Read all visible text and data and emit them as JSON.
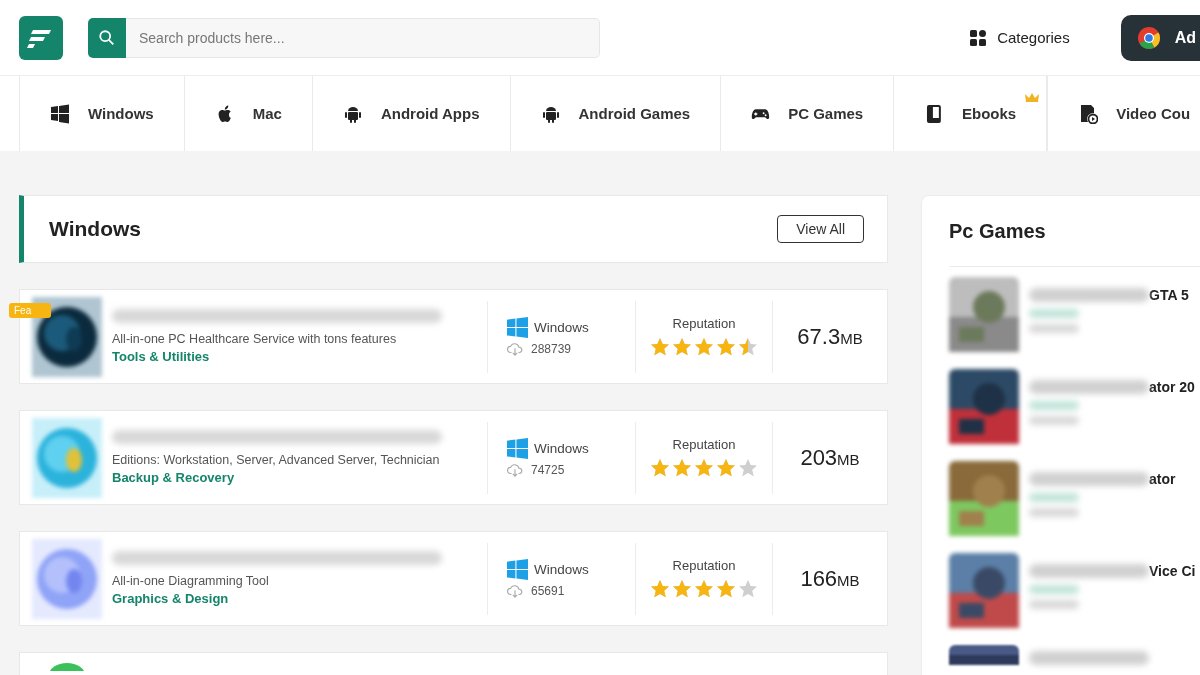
{
  "header": {
    "search": {
      "placeholder": "Search products here..."
    },
    "categories": "Categories",
    "extension_button": "Ad"
  },
  "nav": [
    {
      "kind": "windows",
      "label": "Windows",
      "crown": false
    },
    {
      "kind": "apple",
      "label": "Mac",
      "crown": false
    },
    {
      "kind": "android",
      "label": "Android Apps",
      "crown": false
    },
    {
      "kind": "android",
      "label": "Android Games",
      "crown": false
    },
    {
      "kind": "gamepad",
      "label": "PC Games",
      "crown": false
    },
    {
      "kind": "book",
      "label": "Ebooks",
      "crown": true
    },
    {
      "kind": "video",
      "label": "Video Cou",
      "crown": false
    }
  ],
  "windows_section": {
    "title": "Windows",
    "view_all": "View All",
    "items": [
      {
        "badge": "Fea",
        "description": "All-in-one PC Healthcare Service with tons features",
        "category": "Tools & Utilities",
        "platform": "Windows",
        "downloads": "288739",
        "reputation_label": "Reputation",
        "stars": 4.5,
        "size": "67.3",
        "unit": "MB"
      },
      {
        "description": "Editions: Workstation, Server, Advanced Server, Technician",
        "category": "Backup & Recovery",
        "platform": "Windows",
        "downloads": "74725",
        "reputation_label": "Reputation",
        "stars": 4,
        "size": "203",
        "unit": "MB"
      },
      {
        "description": "All-in-one Diagramming Tool",
        "category": "Graphics & Design",
        "platform": "Windows",
        "downloads": "65691",
        "reputation_label": "Reputation",
        "stars": 4,
        "size": "166",
        "unit": "MB"
      }
    ]
  },
  "pc_games": {
    "title": "Pc Games",
    "items": [
      {
        "title_end": "GTA 5"
      },
      {
        "title_end": "ator 20"
      },
      {
        "title_end": "ator"
      },
      {
        "title_end": "Vice Ci"
      }
    ]
  }
}
